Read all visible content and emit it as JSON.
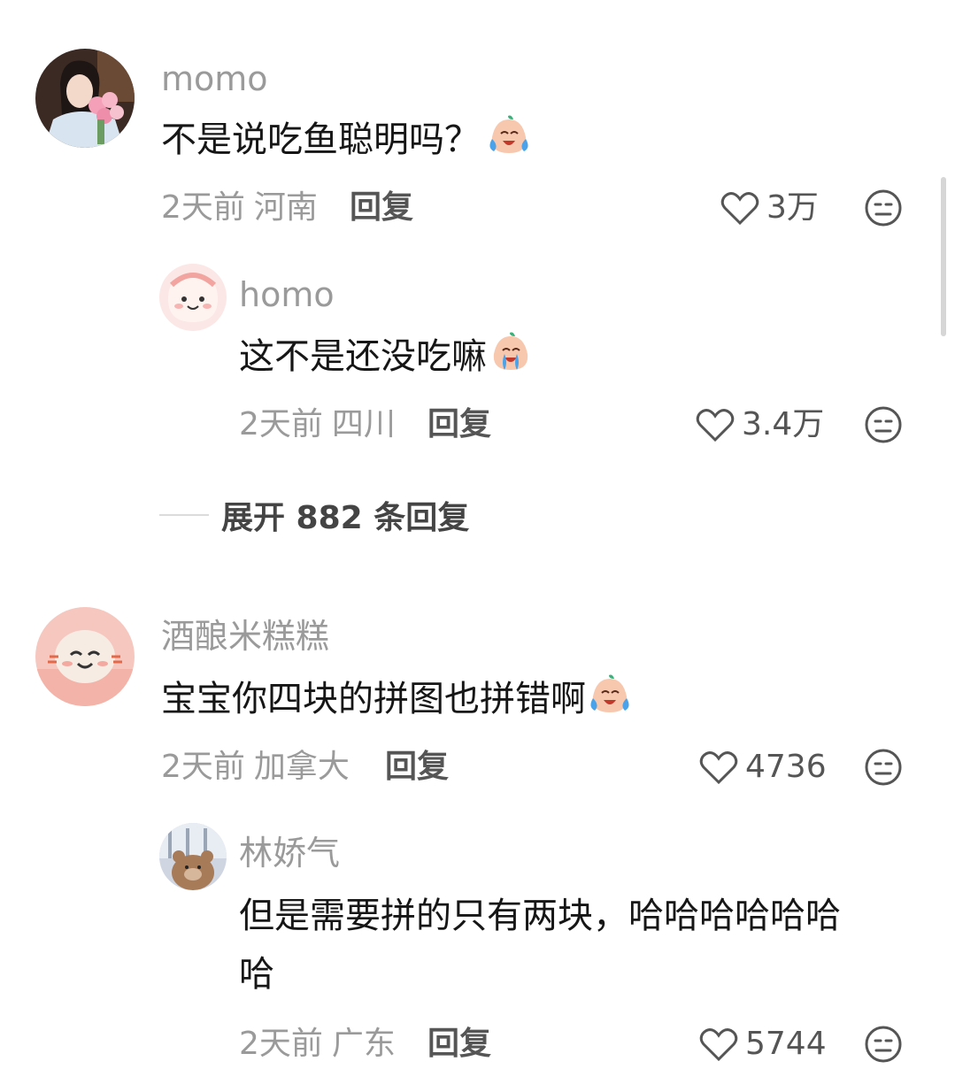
{
  "comments": [
    {
      "username": "momo",
      "text": "不是说吃鱼聪明吗？",
      "time": "2天前",
      "location": "河南",
      "reply_label": "回复",
      "likes": "3万",
      "replies": [
        {
          "username": "homo",
          "text": "这不是还没吃嘛",
          "time": "2天前",
          "location": "四川",
          "reply_label": "回复",
          "likes": "3.4万"
        }
      ],
      "expand_label": "展开 882 条回复"
    },
    {
      "username": "酒酿米糕糕",
      "text": "宝宝你四块的拼图也拼错啊",
      "time": "2天前",
      "location": "加拿大",
      "reply_label": "回复",
      "likes": "4736",
      "replies": [
        {
          "username": "林娇气",
          "text_line1": "但是需要拼的只有两块，哈哈哈哈哈哈",
          "text_line2": "哈",
          "time": "2天前",
          "location": "广东",
          "reply_label": "回复",
          "likes": "5744"
        }
      ]
    }
  ],
  "icons": {
    "like": "heart-outline-icon",
    "dislike": "neutral-face-icon",
    "emoji": "crying-laughing-emoji-icon"
  },
  "colors": {
    "username": "#9a9a9a",
    "text": "#161616",
    "meta": "#9a9a9a",
    "action": "#555555"
  }
}
